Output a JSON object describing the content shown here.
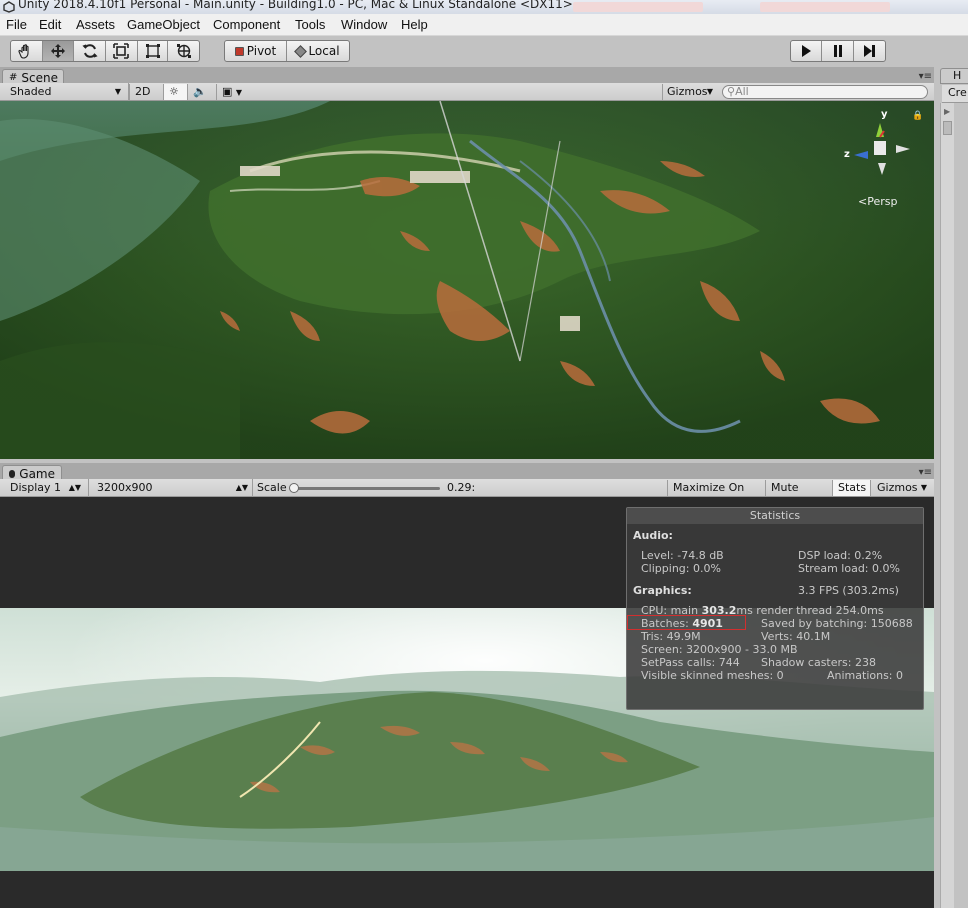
{
  "window": {
    "title": "Unity 2018.4.10f1 Personal - Main.unity - Building1.0 - PC, Mac & Linux Standalone <DX11>"
  },
  "menu": [
    "File",
    "Edit",
    "Assets",
    "GameObject",
    "Component",
    "Tools",
    "Window",
    "Help"
  ],
  "toolbar": {
    "tools": [
      {
        "icon": "hand-icon",
        "active": false
      },
      {
        "icon": "move-icon",
        "active": true
      },
      {
        "icon": "rotate-icon",
        "active": false
      },
      {
        "icon": "scale-icon",
        "active": false
      },
      {
        "icon": "rect-tool-icon",
        "active": false
      },
      {
        "icon": "transform-tool-icon",
        "active": false
      }
    ],
    "pivot_label": "Pivot",
    "local_label": "Local",
    "play_icon": "play-icon",
    "pause_icon": "pause-icon",
    "step_icon": "step-icon"
  },
  "scene": {
    "tab_label": "Scene",
    "shading": "Shaded",
    "mode_2d": "2D",
    "gizmos": "Gizmos",
    "search_placeholder": "All",
    "gizmo": {
      "y": "y",
      "z": "z",
      "persp": "Persp"
    }
  },
  "game": {
    "tab_label": "Game",
    "display": "Display 1",
    "resolution": "3200x900",
    "scale_label": "Scale",
    "scale_value": "0.29:",
    "maximize": "Maximize On Play",
    "mute": "Mute Audio",
    "stats": "Stats",
    "gizmos": "Gizmos"
  },
  "statistics": {
    "title": "Statistics",
    "audio_header": "Audio:",
    "level": "Level: -74.8 dB",
    "dsp_load": "DSP load: 0.2%",
    "clipping": "Clipping: 0.0%",
    "stream_load": "Stream load: 0.0%",
    "graphics_header": "Graphics:",
    "fps": "3.3 FPS (303.2ms)",
    "cpu_prefix": "CPU: main",
    "cpu_main": "303.2",
    "cpu_suffix": "ms  render thread 254.0ms",
    "batches_prefix": "Batches:",
    "batches": "4901",
    "saved_batching": "Saved by batching: 150688",
    "tris": "Tris: 49.9M",
    "verts": "Verts: 40.1M",
    "screen": "Screen: 3200x900 - 33.0 MB",
    "setpass": "SetPass calls: 744",
    "shadow_casters": "Shadow casters: 238",
    "skinned": "Visible skinned meshes: 0",
    "animations": "Animations: 0"
  },
  "right_panel": {
    "tab": "H",
    "create": "Cre"
  },
  "colors": {
    "highlight": "#d12f2f",
    "panel_bg": "#c2c2c2",
    "stats_bg": "#3a3a3a"
  }
}
